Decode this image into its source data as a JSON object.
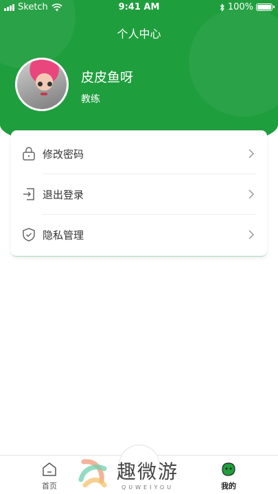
{
  "status_bar": {
    "carrier": "Sketch",
    "time": "9:41 AM",
    "battery": "100%",
    "battery_level": 1.0
  },
  "header": {
    "title": "个人中心",
    "user_name": "皮皮鱼呀",
    "user_role": "教练",
    "accent_color": "#1f9e3e"
  },
  "menu": {
    "items": [
      {
        "label": "修改密码",
        "icon": "lock-icon"
      },
      {
        "label": "退出登录",
        "icon": "logout-icon"
      },
      {
        "label": "隐私管理",
        "icon": "shield-icon"
      }
    ]
  },
  "tabbar": {
    "tabs": [
      {
        "label": "首页",
        "icon": "home-icon"
      },
      {
        "label": "我的",
        "icon": "profile-icon",
        "active": true
      }
    ]
  },
  "watermark": {
    "text": "趣微游",
    "subtext": "QUWEIYOU"
  }
}
